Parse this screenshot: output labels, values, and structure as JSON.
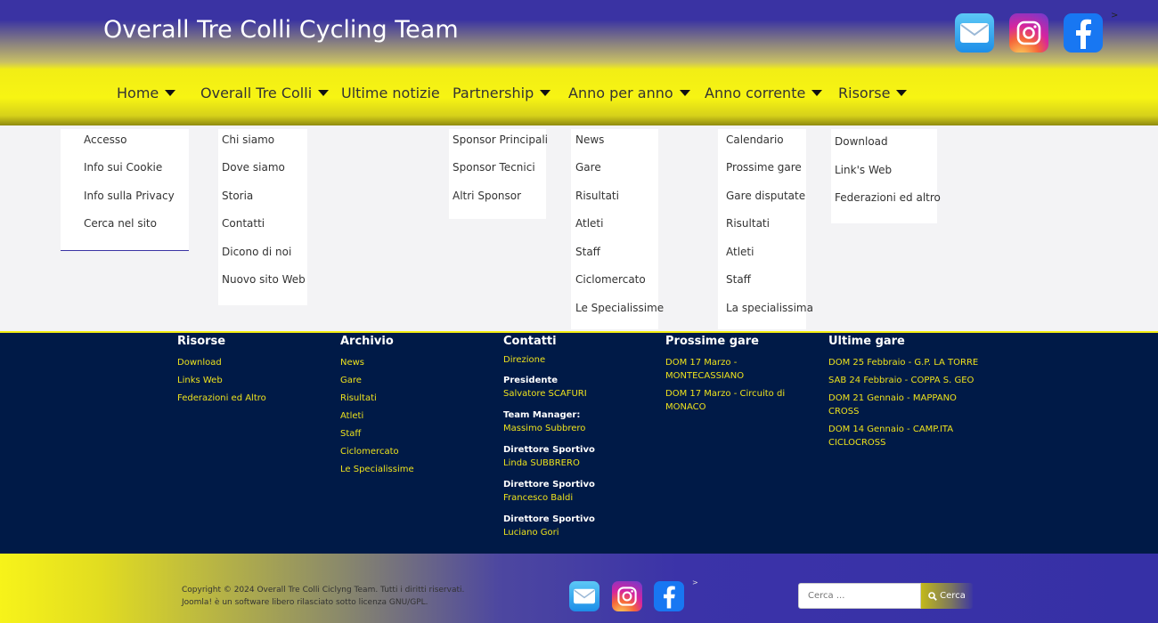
{
  "header": {
    "title": "Overall Tre Colli Cycling Team",
    "corner_mark": ">",
    "social_icons": [
      "mail-icon",
      "instagram-icon",
      "facebook-icon"
    ]
  },
  "nav": {
    "items": [
      {
        "label": "Home",
        "has_caret": true
      },
      {
        "label": "Overall Tre Colli",
        "has_caret": true
      },
      {
        "label": "Ultime notizie",
        "has_caret": false
      },
      {
        "label": "Partnership",
        "has_caret": true
      },
      {
        "label": "Anno per anno",
        "has_caret": true
      },
      {
        "label": "Anno corrente",
        "has_caret": true
      },
      {
        "label": "Risorse",
        "has_caret": true
      }
    ]
  },
  "dropdowns": {
    "home": [
      "Accesso",
      "Info sui Cookie",
      "Info sulla Privacy",
      "Cerca nel sito"
    ],
    "overall": [
      "Chi siamo",
      "Dove siamo",
      "Storia",
      "Contatti",
      "Dicono di noi",
      "Nuovo sito Web"
    ],
    "partnership": [
      "Sponsor Principali",
      "Sponsor Tecnici",
      "Altri Sponsor"
    ],
    "anno_per_anno": [
      "News",
      "Gare",
      "Risultati",
      "Atleti",
      "Staff",
      "Ciclomercato",
      "Le Specialissime"
    ],
    "anno_corrente": [
      "Calendario",
      "Prossime gare",
      "Gare disputate",
      "Risultati",
      "Atleti",
      "Staff",
      "La specialissima"
    ],
    "risorse": [
      "Download",
      "Link's Web",
      "Federazioni ed altro"
    ]
  },
  "footer": {
    "risorse": {
      "heading": "Risorse",
      "links": [
        "Download",
        "Links Web",
        "Federazioni ed Altro"
      ]
    },
    "archivio": {
      "heading": "Archivio",
      "links": [
        "News",
        "Gare",
        "Risultati",
        "Atleti",
        "Staff",
        "Ciclomercato",
        "Le Specialissime"
      ]
    },
    "contatti": {
      "heading": "Contatti",
      "direzione": "Direzione",
      "people": [
        {
          "role": "Presidente",
          "name": "Salvatore SCAFURI"
        },
        {
          "role": "Team Manager:",
          "name": "Massimo Subbrero"
        },
        {
          "role": "Direttore Sportivo",
          "name": "Linda SUBBRERO"
        },
        {
          "role": "Direttore Sportivo",
          "name": "Francesco Baldi"
        },
        {
          "role": "Direttore Sportivo",
          "name": "Luciano Gori"
        }
      ]
    },
    "prossime": {
      "heading": "Prossime gare",
      "links": [
        [
          "DOM 17 Marzo -",
          "MONTECASSIANO"
        ],
        [
          "DOM 17 Marzo - Circuito di",
          "MONACO"
        ]
      ]
    },
    "ultime": {
      "heading": "Ultime gare",
      "links": [
        [
          "DOM 25 Febbraio - G.P. LA TORRE"
        ],
        [
          "SAB 24 Febbraio - COPPA S. GEO"
        ],
        [
          "DOM 21 Gennaio - MAPPANO",
          "CROSS"
        ],
        [
          "DOM 14 Gennaio - CAMP.ITA",
          "CICLOCROSS"
        ]
      ]
    }
  },
  "bottom": {
    "copyright_line1": "Copyright © 2024 Overall Tre Colli Ciclyng Team. Tutti i diritti riservati.",
    "copyright_line2": "Joomla! è un software libero rilasciato sotto licenza GNU/GPL.",
    "corner_mark": ">",
    "search_placeholder": "Cerca ...",
    "search_button": "Cerca"
  }
}
